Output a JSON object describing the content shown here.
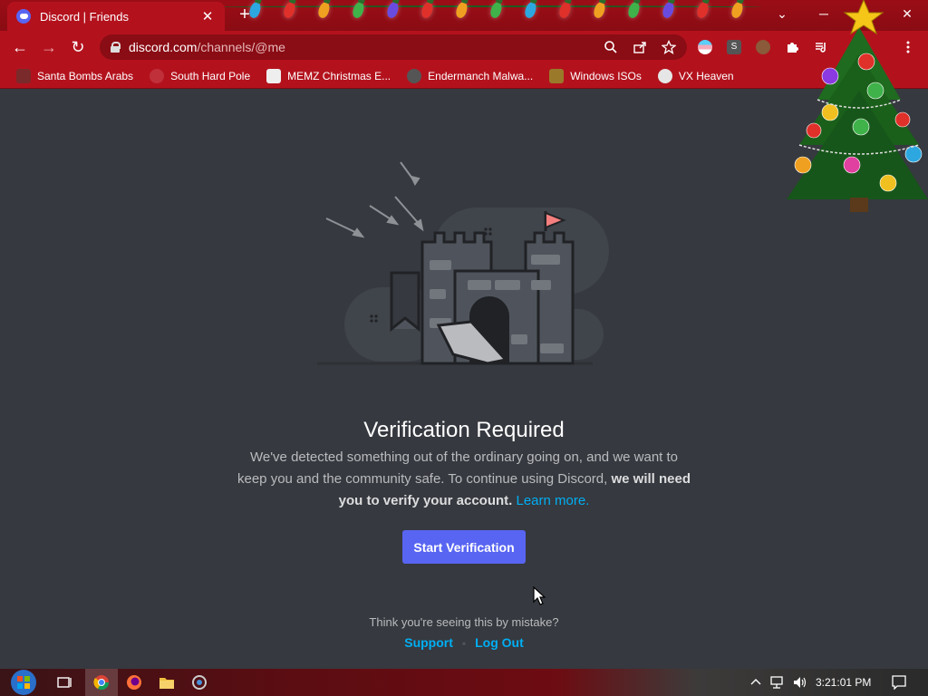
{
  "browser": {
    "tab_title": "Discord | Friends",
    "tab_close": "✕",
    "new_tab": "+",
    "url_host": "discord.com",
    "url_path": "/channels/@me",
    "window_controls": {
      "dropdown": "⌄",
      "minimize": "─",
      "close": "✕"
    },
    "nav": {
      "back": "←",
      "forward": "→",
      "reload": "↻"
    },
    "icons": {
      "zoom": "search-icon",
      "share": "share-icon",
      "bookmark": "star-icon",
      "extensions": "puzzle-icon",
      "media": "media-icon",
      "menu": "kebab-menu-icon"
    }
  },
  "bookmarks": [
    {
      "label": "Santa Bombs Arabs",
      "color": "#7a2a2a"
    },
    {
      "label": "South Hard Pole",
      "color": "#c0303a"
    },
    {
      "label": "MEMZ Christmas E...",
      "color": "#eeeeee"
    },
    {
      "label": "Endermanch Malwa...",
      "color": "#555555"
    },
    {
      "label": "Windows ISOs",
      "color": "#9a7a2a"
    },
    {
      "label": "VX Heaven",
      "color": "#e6e6e6"
    }
  ],
  "page": {
    "heading": "Verification Required",
    "description_1": "We've detected something out of the ordinary going on, and we want to keep you and the community safe. To continue using Discord,",
    "description_bold": "we will need you to verify your account.",
    "learn_more": "Learn more.",
    "start_button": "Start Verification",
    "mistake_text": "Think you're seeing this by mistake?",
    "support_link": "Support",
    "separator": "•",
    "logout_link": "Log Out"
  },
  "taskbar": {
    "clock": "3:21:01 PM"
  },
  "colors": {
    "accent": "#5865f2",
    "link": "#00aff4",
    "background": "#36393f",
    "browser_theme": "#b3121d"
  }
}
